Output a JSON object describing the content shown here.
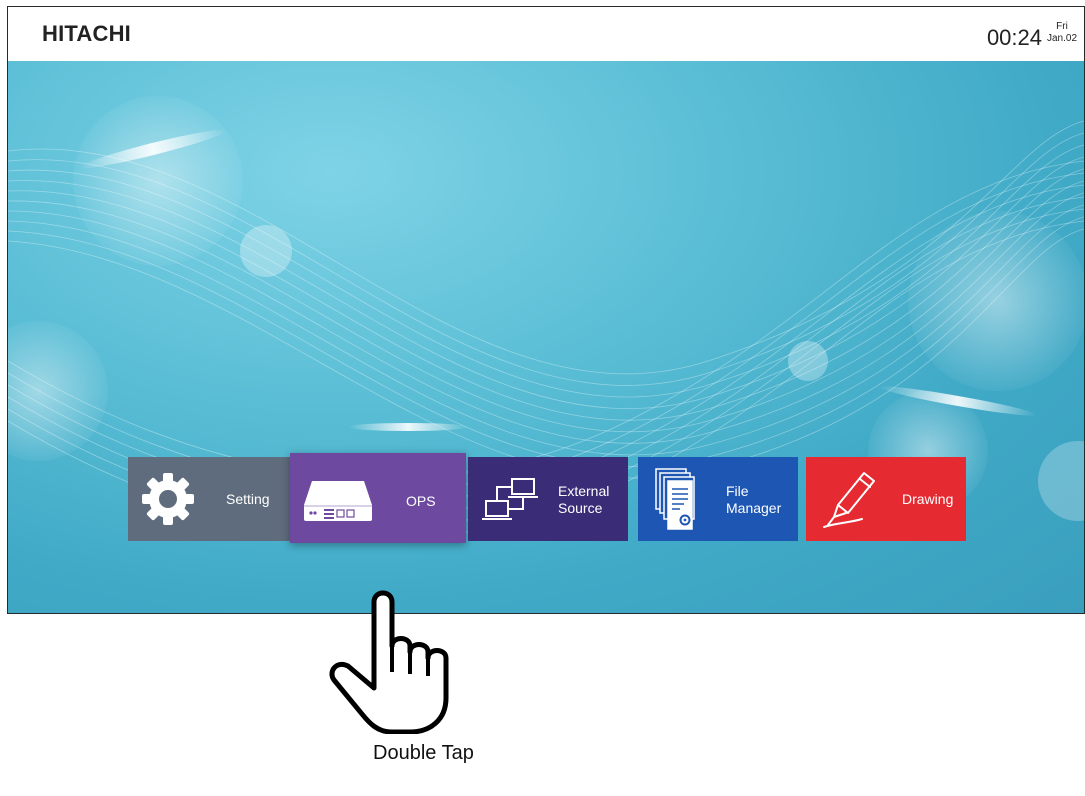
{
  "topbar": {
    "brand": "HITACHI",
    "time": "00:24",
    "weekday": "Fri",
    "date": "Jan.02"
  },
  "launcher": {
    "tiles": [
      {
        "label": "Setting",
        "icon": "gear-icon",
        "color": "#5f6c7d"
      },
      {
        "label": "OPS",
        "icon": "ops-box-icon",
        "color": "#6d4aa0",
        "selected": true
      },
      {
        "label_line1": "External",
        "label_line2": "Source",
        "icon": "external-source-icon",
        "color": "#3b2c77"
      },
      {
        "label_line1": "File",
        "label_line2": "Manager",
        "icon": "file-manager-icon",
        "color": "#1e56b3"
      },
      {
        "label": "Drawing",
        "icon": "pen-icon",
        "color": "#e52a31"
      }
    ]
  },
  "annotation": {
    "gesture_icon": "hand-pointer-icon",
    "caption": "Double Tap"
  },
  "colors": {
    "wallpaper_accent": "#4fb6d1"
  }
}
